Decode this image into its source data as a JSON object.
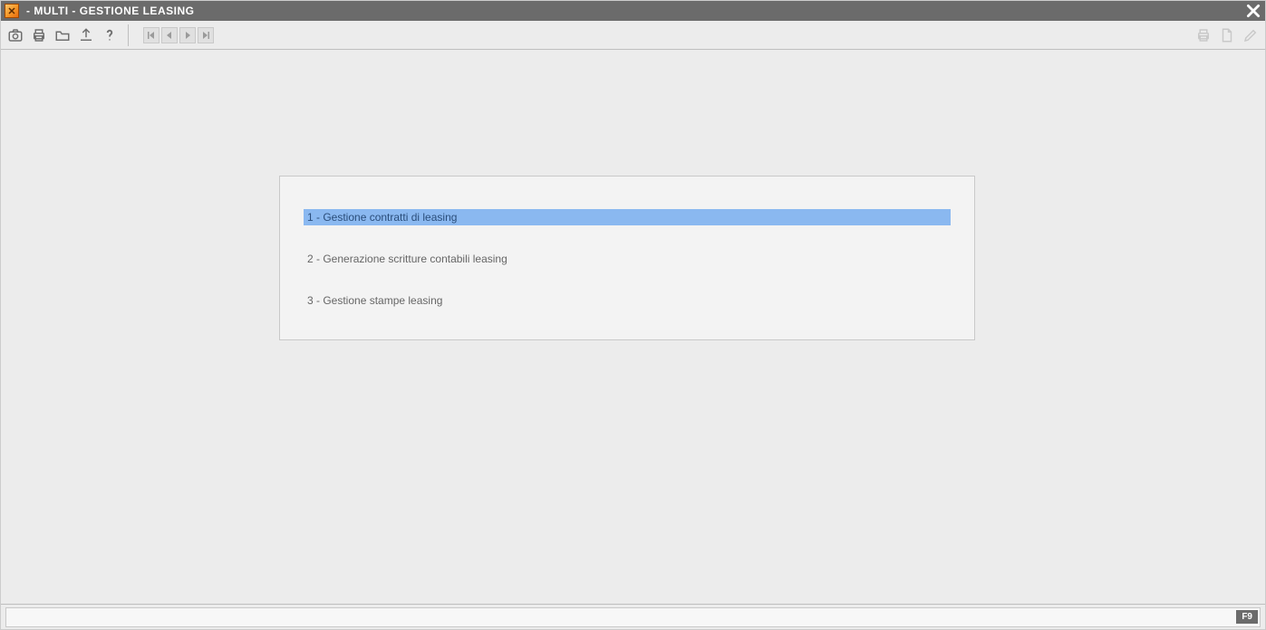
{
  "titlebar": {
    "title": " - MULTI -  GESTIONE LEASING"
  },
  "menu": {
    "items": [
      {
        "label": "1 - Gestione contratti di leasing",
        "selected": true
      },
      {
        "label": "2 - Generazione scritture contabili leasing",
        "selected": false
      },
      {
        "label": "3 - Gestione stampe leasing",
        "selected": false
      }
    ]
  },
  "statusbar": {
    "fkey": "F9"
  }
}
